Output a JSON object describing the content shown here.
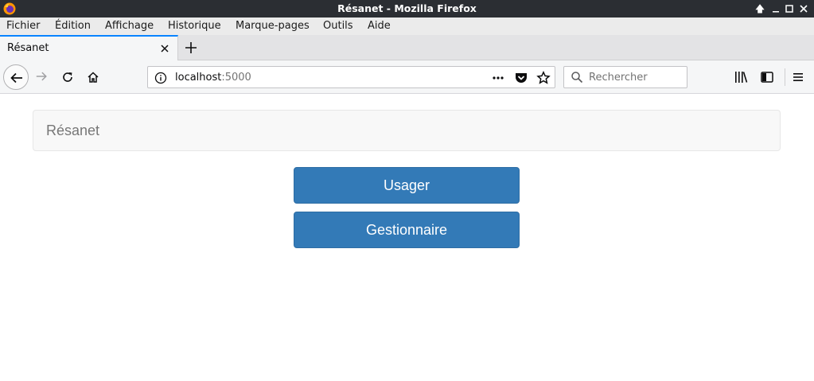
{
  "window": {
    "title": "Résanet - Mozilla Firefox"
  },
  "menubar": {
    "items": [
      {
        "label": "Fichier"
      },
      {
        "label": "Édition"
      },
      {
        "label": "Affichage"
      },
      {
        "label": "Historique"
      },
      {
        "label": "Marque-pages"
      },
      {
        "label": "Outils"
      },
      {
        "label": "Aide"
      }
    ]
  },
  "tabs": [
    {
      "label": "Résanet",
      "active": true
    }
  ],
  "urlbar": {
    "host": "localhost",
    "port": ":5000"
  },
  "search": {
    "placeholder": "Rechercher"
  },
  "page": {
    "brand": "Résanet",
    "buttons": {
      "usager": "Usager",
      "gestionnaire": "Gestionnaire"
    }
  },
  "colors": {
    "accent": "#0a84ff",
    "button_primary": "#337ab7",
    "titlebar": "#2b2e33"
  },
  "icons": [
    "firefox-logo-icon",
    "back-icon",
    "forward-icon",
    "reload-icon",
    "home-icon",
    "info-icon",
    "page-actions-icon",
    "pocket-icon",
    "bookmark-star-icon",
    "search-icon",
    "library-icon",
    "sidebar-icon",
    "hamburger-menu-icon"
  ]
}
